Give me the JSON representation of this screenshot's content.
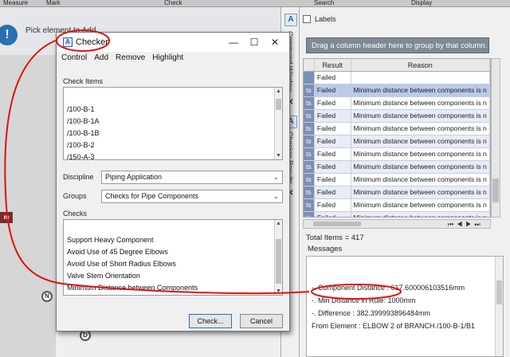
{
  "ribbon": {
    "labels": [
      "Measure",
      "Mark",
      "Check",
      "Search",
      "Display"
    ]
  },
  "viewport": {
    "hint": "Pick element to Add",
    "unit_tag": "m",
    "node_n": "N",
    "node_d": "D"
  },
  "side_tabs": {
    "command_window": "Command Window",
    "checker_results": "Checker Results"
  },
  "results_panel": {
    "labels_checkbox": "Labels",
    "group_hint": "Drag a column header here to group by that column.",
    "columns": [
      "Result",
      "Reason"
    ],
    "id_fragment": "ts",
    "rows": [
      {
        "result": "Failed",
        "reason": ""
      },
      {
        "result": "Failed",
        "reason": "Minimum distance between components is n"
      },
      {
        "result": "Failed",
        "reason": "Minimum distance between components is n"
      },
      {
        "result": "Failed",
        "reason": "Minimum distance between components is n"
      },
      {
        "result": "Failed",
        "reason": "Minimum distance between components is n"
      },
      {
        "result": "Failed",
        "reason": "Minimum distance between components is n"
      },
      {
        "result": "Failed",
        "reason": "Minimum distance between components is n"
      },
      {
        "result": "Failed",
        "reason": "Minimum distance between components is n"
      },
      {
        "result": "Failed",
        "reason": "Minimum distance between components is n"
      },
      {
        "result": "Failed",
        "reason": "Minimum distance between components is n"
      },
      {
        "result": "Failed",
        "reason": "Minimum distance between components is n"
      },
      {
        "result": "Failed",
        "reason": "Minimum distance between components is n"
      }
    ],
    "total_items": "Total Items = 417",
    "messages_title": "Messages",
    "messages": [
      "-. Component Distance : 617.600006103516mm",
      "-. Min Distance in Rule: 1000mm",
      "-. Difference : 382.399993896484mm",
      "From Element : ELBOW 2 of BRANCH /100-B-1/B1"
    ]
  },
  "checker": {
    "title": "Checker",
    "menu": [
      "Control",
      "Add",
      "Remove",
      "Highlight"
    ],
    "check_items_label": "Check Items",
    "check_items": [
      "/100-B-1",
      "/100-B-1A",
      "/100-B-1B",
      "/100-B-2",
      "/150-A-3"
    ],
    "discipline_label": "Discipline",
    "discipline_value": "Piping Application",
    "groups_label": "Groups",
    "groups_value": "Checks for Pipe Components",
    "checks_label": "Checks",
    "checks": [
      "Support Heavy Component",
      "Avoid Use of 45 Degree Elbows",
      "Avoid Use of Short Radius Elbows",
      "Valve Stem Orientation",
      "Minimum Distance between Components"
    ],
    "check_button": "Check...",
    "cancel_button": "Cancel"
  },
  "colors": {
    "annotation": "#e01010",
    "selection": "#b9cbe8",
    "group_box": "#7e8a96"
  }
}
